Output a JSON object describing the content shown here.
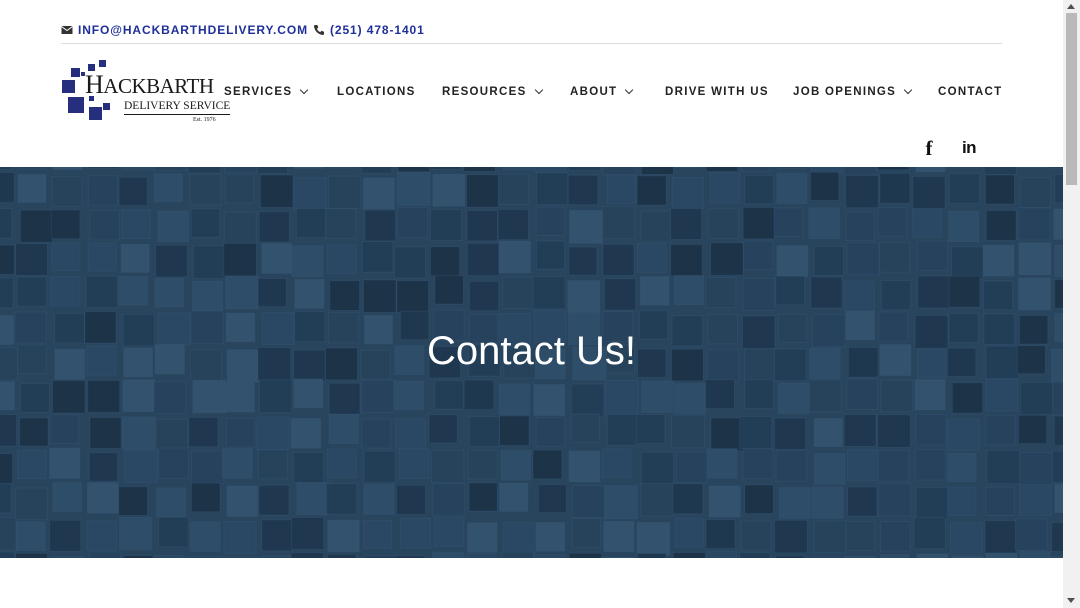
{
  "topbar": {
    "email": "INFO@HACKBARTHDELIVERY.COM",
    "phone": "(251) 478-1401",
    "email_icon": "envelope-icon",
    "phone_icon": "phone-icon"
  },
  "logo": {
    "name_initial": "H",
    "name_rest": "ACKBARTH",
    "subtitle": "DELIVERY SERVICE",
    "established": "Est. 1976"
  },
  "nav": {
    "items": [
      {
        "label": "SERVICES",
        "has_dropdown": true
      },
      {
        "label": "LOCATIONS",
        "has_dropdown": false
      },
      {
        "label": "RESOURCES",
        "has_dropdown": true
      },
      {
        "label": "ABOUT",
        "has_dropdown": true
      },
      {
        "label": "DRIVE WITH US",
        "has_dropdown": false
      },
      {
        "label": "JOB OPENINGS",
        "has_dropdown": true
      },
      {
        "label": "CONTACT",
        "has_dropdown": false
      }
    ]
  },
  "social": {
    "facebook_glyph": "f",
    "linkedin_glyph": "in",
    "facebook_icon": "facebook-icon",
    "linkedin_icon": "linkedin-icon"
  },
  "hero": {
    "title": "Contact Us!"
  },
  "colors": {
    "brand_blue": "#1f2f9a",
    "logo_square": "#252f7d",
    "hero_base": "#2d4a63",
    "nav_text": "#222222"
  }
}
